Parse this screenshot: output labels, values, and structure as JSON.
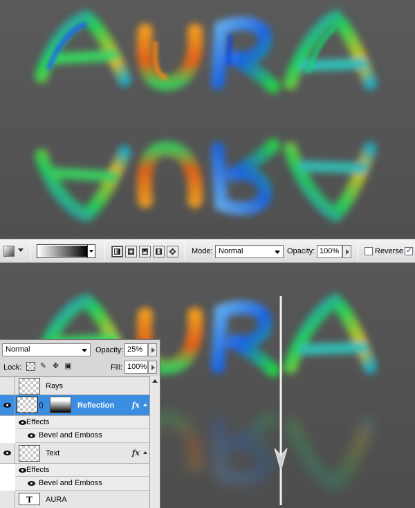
{
  "options_bar": {
    "mode_label": "Mode:",
    "mode_value": "Normal",
    "opacity_label": "Opacity:",
    "opacity_value": "100%",
    "reverse_label": "Reverse",
    "reverse_checked": false,
    "dither_checked": true,
    "gradient_types": [
      "linear",
      "radial",
      "angle",
      "reflected",
      "diamond"
    ],
    "active_gradient_type": "linear"
  },
  "layers_panel": {
    "blend_mode": "Normal",
    "opacity_label": "Opacity:",
    "opacity_value": "25%",
    "lock_label": "Lock:",
    "fill_label": "Fill:",
    "fill_value": "100%",
    "layers": {
      "rays": {
        "name": "Rays",
        "visible": false
      },
      "reflection": {
        "name": "Reflection",
        "visible": true,
        "selected": true,
        "fx": "fx",
        "effects_label": "Effects",
        "effect": "Bevel and Emboss"
      },
      "text": {
        "name": "Text",
        "visible": true,
        "fx": "fx",
        "effects_label": "Effects",
        "effect": "Bevel and Emboss"
      },
      "aura": {
        "name": "AURA",
        "visible": false,
        "type_glyph": "T"
      }
    }
  },
  "colors": {
    "selected_row": "#3a8de0",
    "canvas_bg": "#555555",
    "gradient_arrow": "#ffffff"
  }
}
